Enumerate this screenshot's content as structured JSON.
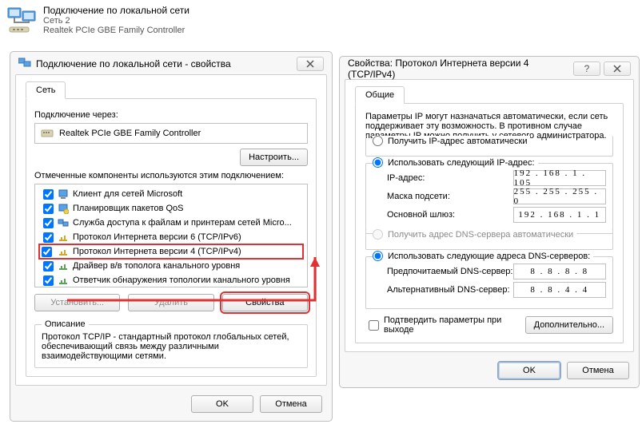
{
  "header": {
    "title": "Подключение по локальной сети",
    "subtitle1": "Сеть 2",
    "subtitle2": "Realtek PCIe GBE Family Controller"
  },
  "dlg1": {
    "title": "Подключение по локальной сети - свойства",
    "tab": "Сеть",
    "connect_label": "Подключение через:",
    "adapter": "Realtek PCIe GBE Family Controller",
    "configure": "Настроить...",
    "components_label": "Отмеченные компоненты используются этим подключением:",
    "items": [
      "Клиент для сетей Microsoft",
      "Планировщик пакетов QoS",
      "Служба доступа к файлам и принтерам сетей Micro...",
      "Протокол Интернета версии 6 (TCP/IPv6)",
      "Протокол Интернета версии 4 (TCP/IPv4)",
      "Драйвер в/в тополога канального уровня",
      "Ответчик обнаружения топологии канального уровня"
    ],
    "install": "Установить...",
    "remove": "Удалить",
    "props": "Свойства",
    "desc_legend": "Описание",
    "desc_text": "Протокол TCP/IP - стандартный протокол глобальных сетей, обеспечивающий связь между различными взаимодействующими сетями.",
    "ok": "OK",
    "cancel": "Отмена"
  },
  "dlg2": {
    "title": "Свойства: Протокол Интернета версии 4 (TCP/IPv4)",
    "tab": "Общие",
    "intro": "Параметры IP могут назначаться автоматически, если сеть поддерживает эту возможность. В противном случае параметры IP можно получить у сетевого администратора.",
    "radio_auto_ip": "Получить IP-адрес автоматически",
    "radio_manual_ip": "Использовать следующий IP-адрес:",
    "ip_label": "IP-адрес:",
    "ip_value": "192 . 168 .   1  . 105",
    "mask_label": "Маска подсети:",
    "mask_value": "255 . 255 . 255 .   0",
    "gw_label": "Основной шлюз:",
    "gw_value": "192 . 168 .   1  .   1",
    "radio_auto_dns": "Получить адрес DNS-сервера автоматически",
    "radio_manual_dns": "Использовать следующие адреса DNS-серверов:",
    "dns1_label": "Предпочитаемый DNS-сервер:",
    "dns1_value": "8  .   8  .   8  .   8",
    "dns2_label": "Альтернативный DNS-сервер:",
    "dns2_value": "8  .   8  .   4  .   4",
    "confirm": "Подтвердить параметры при выходе",
    "advanced": "Дополнительно...",
    "ok": "OK",
    "cancel": "Отмена"
  }
}
